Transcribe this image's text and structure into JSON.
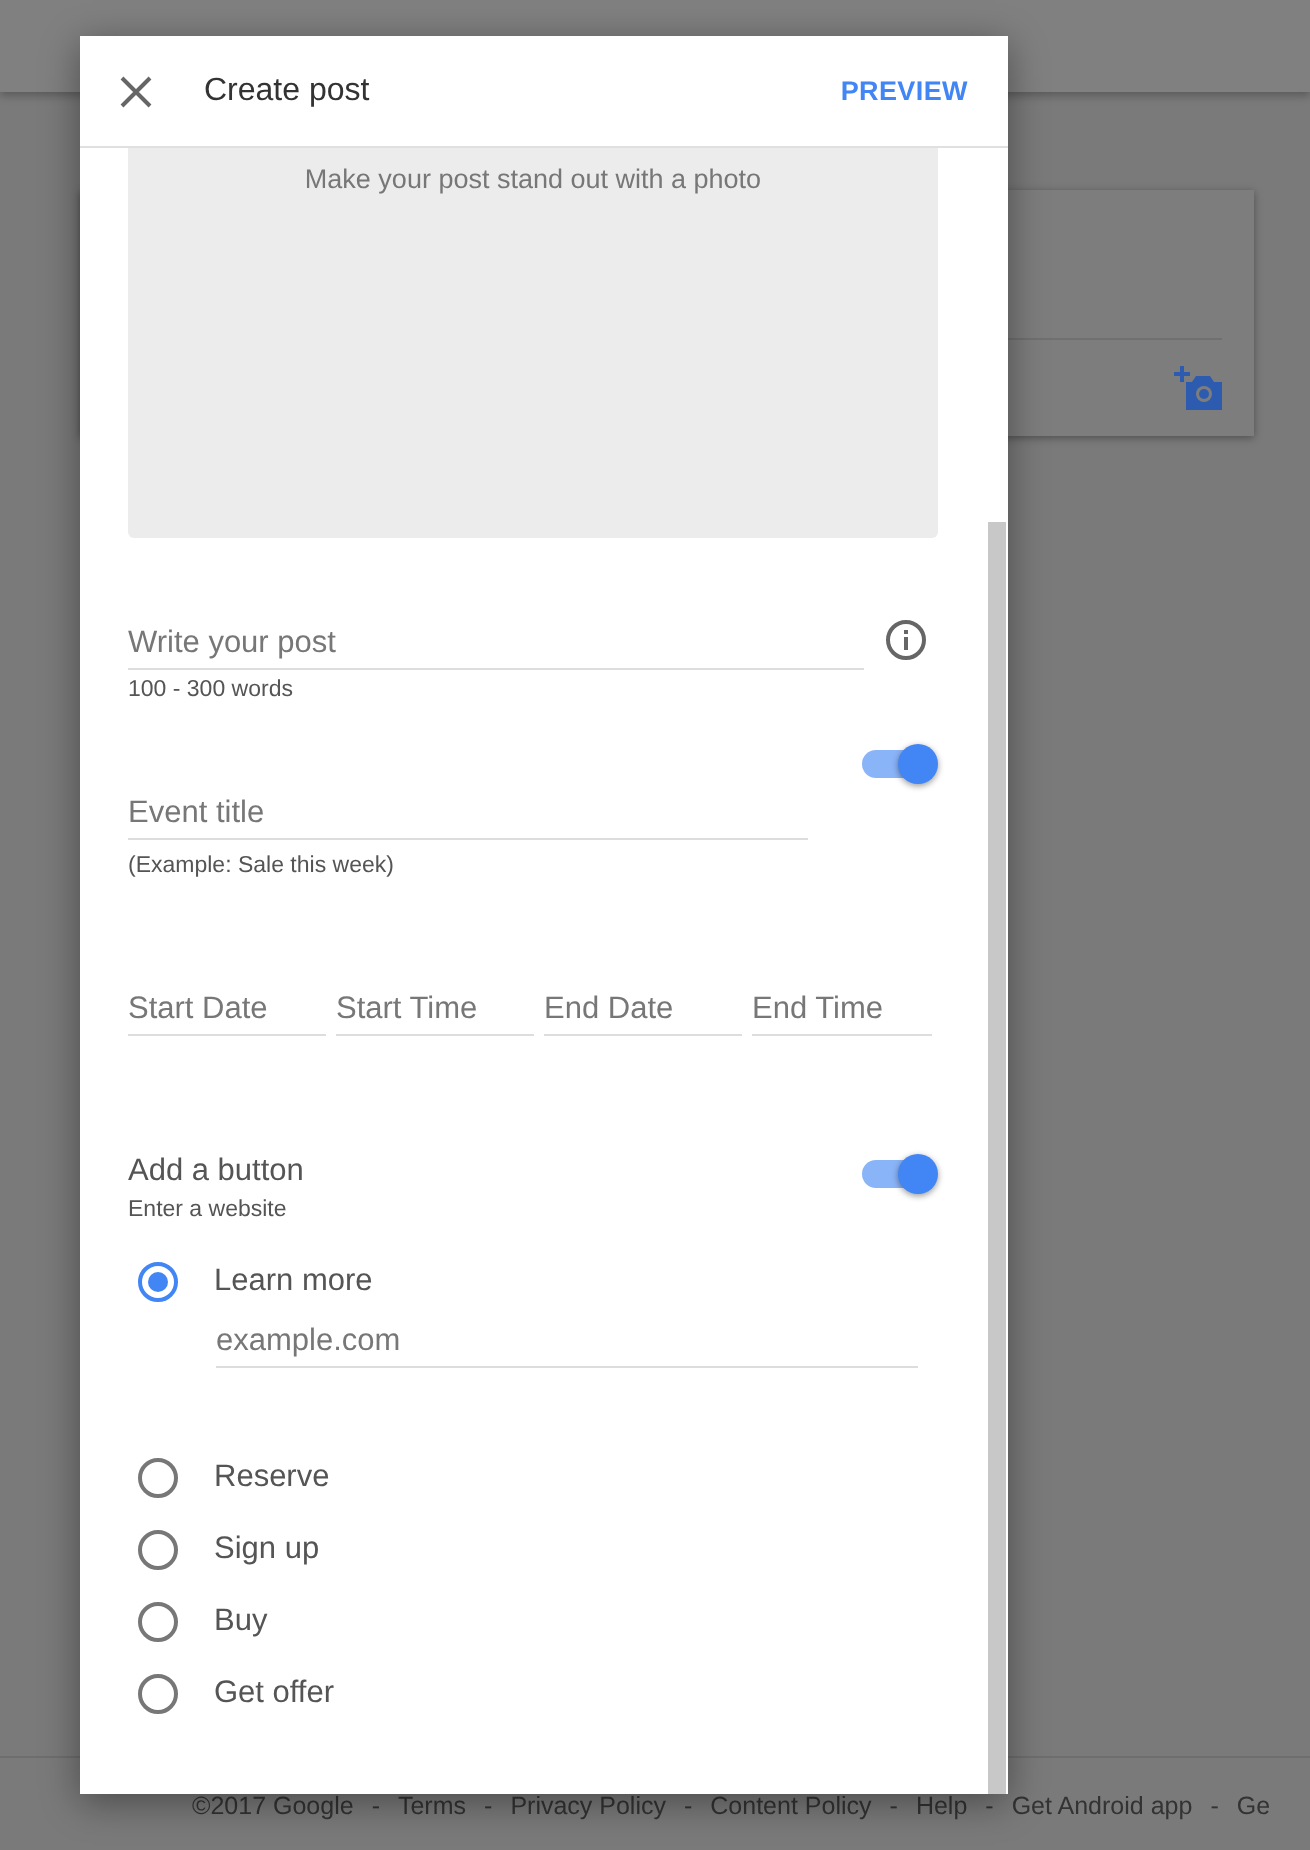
{
  "dialog": {
    "title": "Create post",
    "action": "PREVIEW",
    "photo_prompt": "Make your post stand out with a photo",
    "post": {
      "placeholder": "Write your post",
      "hint": "100 - 300 words"
    },
    "event": {
      "on": true,
      "title_placeholder": "Event title",
      "hint": "(Example: Sale this week)",
      "fields": [
        {
          "placeholder": "Start Date"
        },
        {
          "placeholder": "Start Time"
        },
        {
          "placeholder": "End Date"
        },
        {
          "placeholder": "End Time"
        }
      ]
    },
    "button_section": {
      "title": "Add a button",
      "subtitle": "Enter a website",
      "on": true,
      "url_placeholder": "example.com",
      "options": [
        {
          "label": "Learn more",
          "selected": true
        },
        {
          "label": "Reserve",
          "selected": false
        },
        {
          "label": "Sign up",
          "selected": false
        },
        {
          "label": "Buy",
          "selected": false
        },
        {
          "label": "Get offer",
          "selected": false
        }
      ]
    }
  },
  "footer": {
    "separator": "-",
    "links": [
      "©2017 Google",
      "Terms",
      "Privacy Policy",
      "Content Policy",
      "Help",
      "Get Android app",
      "Ge"
    ]
  }
}
